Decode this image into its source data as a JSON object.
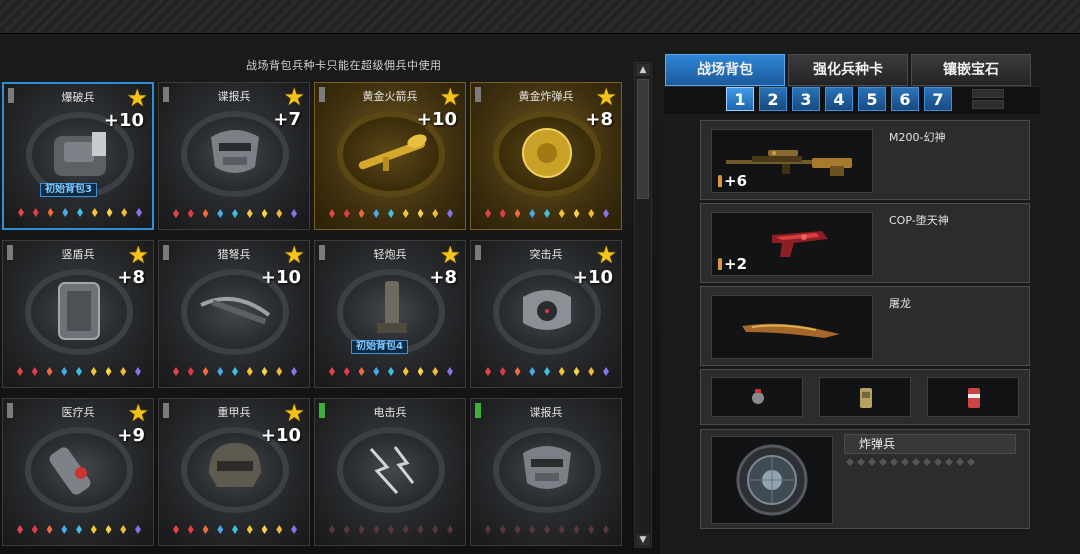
{
  "notice": "战场背包兵种卡只能在超级佣兵中使用",
  "cards": [
    {
      "name": "爆破兵",
      "plus": "+10",
      "star": true,
      "badge": "初始背包3",
      "variant": "selected",
      "icon": "backpack-icon"
    },
    {
      "name": "谍报兵",
      "plus": "+7",
      "star": true,
      "badge": "",
      "variant": "normal",
      "icon": "mask-icon"
    },
    {
      "name": "黄金火箭兵",
      "plus": "+10",
      "star": true,
      "badge": "",
      "variant": "gold",
      "icon": "rocket-launcher-icon"
    },
    {
      "name": "黄金炸弹兵",
      "plus": "+8",
      "star": true,
      "badge": "",
      "variant": "gold",
      "icon": "gold-bomb-icon"
    },
    {
      "name": "竖盾兵",
      "plus": "+8",
      "star": true,
      "badge": "",
      "variant": "normal",
      "icon": "shield-icon"
    },
    {
      "name": "猎弩兵",
      "plus": "+10",
      "star": true,
      "badge": "",
      "variant": "normal",
      "icon": "crossbow-icon"
    },
    {
      "name": "轻炮兵",
      "plus": "+8",
      "star": true,
      "badge": "初始背包4",
      "variant": "normal",
      "icon": "mortar-icon"
    },
    {
      "name": "突击兵",
      "plus": "+10",
      "star": true,
      "badge": "",
      "variant": "normal",
      "icon": "target-device-icon"
    },
    {
      "name": "医疗兵",
      "plus": "+9",
      "star": true,
      "badge": "",
      "variant": "normal",
      "icon": "medkit-icon"
    },
    {
      "name": "重甲兵",
      "plus": "+10",
      "star": true,
      "badge": "",
      "variant": "normal",
      "icon": "helmet-icon"
    },
    {
      "name": "电击兵",
      "plus": "",
      "star": false,
      "badge": "",
      "variant": "normal",
      "icon": "electric-icon",
      "tab": "green"
    },
    {
      "name": "谍报兵",
      "plus": "",
      "star": false,
      "badge": "",
      "variant": "normal",
      "icon": "mask-icon",
      "tab": "green"
    }
  ],
  "tabs": [
    "战场背包",
    "强化兵种卡",
    "镶嵌宝石"
  ],
  "active_tab": 0,
  "pages": [
    "1",
    "2",
    "3",
    "4",
    "5",
    "6",
    "7"
  ],
  "active_page": 0,
  "weapons": [
    {
      "name": "M200-幻神",
      "count": "+6",
      "icon": "sniper-rifle-icon"
    },
    {
      "name": "COP-堕天神",
      "count": "+2",
      "icon": "pistol-icon"
    },
    {
      "name": "屠龙",
      "count": "",
      "icon": "knife-icon"
    }
  ],
  "grenades": [
    "flash-grenade-icon",
    "smoke-grenade-icon",
    "grenade-icon"
  ],
  "class_card": {
    "name": "炸弹兵",
    "icon": "bomb-icon"
  }
}
